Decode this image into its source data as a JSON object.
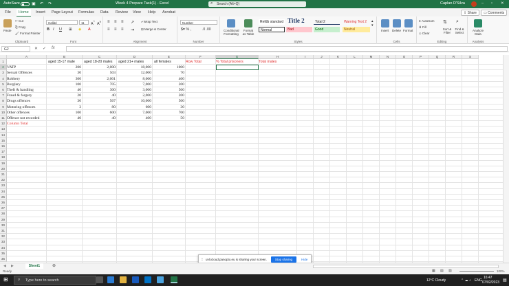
{
  "titlebar": {
    "autosave": "AutoSave",
    "autosave_state": "Off",
    "doc_title": "Week 4 Prepare Task(1) - Excel",
    "search": "Search (Alt+Q)",
    "user": "Caplan D'Silva"
  },
  "tabs": [
    "File",
    "Home",
    "Insert",
    "Page Layout",
    "Formulas",
    "Data",
    "Review",
    "View",
    "Help",
    "Acrobat"
  ],
  "active_tab": "Home",
  "share_label": "Share",
  "comments_label": "Comments",
  "ribbon": {
    "clipboard": {
      "label": "Clipboard",
      "paste": "Paste",
      "cut": "Cut",
      "copy": "Copy",
      "format_painter": "Format Painter"
    },
    "font": {
      "label": "Font",
      "name": "Calibri",
      "size": "11"
    },
    "alignment": {
      "label": "Alignment",
      "wrap": "Wrap Text",
      "merge": "Merge & Center"
    },
    "number": {
      "label": "Number",
      "format": "Number"
    },
    "styles": {
      "label": "Styles",
      "cond": "Conditional Formatting",
      "table": "Format as Table",
      "cells": [
        "Refdb standard",
        "Title 2",
        "Total 2",
        "Warning Text 2",
        "Normal",
        "Bad",
        "Good",
        "Neutral"
      ]
    },
    "cells": {
      "label": "Cells",
      "insert": "Insert",
      "delete": "Delete",
      "format": "Format"
    },
    "editing": {
      "label": "Editing",
      "autosum": "AutoSum",
      "fill": "Fill",
      "clear": "Clear",
      "sort": "Sort & Filter",
      "find": "Find & Select"
    },
    "analysis": {
      "label": "Analysis",
      "analyze": "Analyze Data"
    }
  },
  "formula_bar": {
    "name_box": "G2",
    "fx": "fx",
    "content": ""
  },
  "columns": [
    "A",
    "B",
    "C",
    "D",
    "E",
    "F",
    "G",
    "H",
    "I",
    "J",
    "K",
    "L",
    "M",
    "N",
    "O",
    "P",
    "Q",
    "R",
    "S"
  ],
  "row_count": 36,
  "headers_row1": {
    "B": "aged 15-17 male",
    "C": "aged 18-20 males",
    "D": "aged 21+ males",
    "E": "all females",
    "F": "Row Total",
    "G": "% Total prisoners",
    "H": "Total males"
  },
  "rows": [
    {
      "A": "VATP",
      "B": "200",
      "C": "2,000",
      "D": "18,000",
      "E": "1000"
    },
    {
      "A": "Sexual Offences",
      "B": "30",
      "C": "503",
      "D": "12,000",
      "E": "70"
    },
    {
      "A": "Robbery",
      "B": "300",
      "C": "2,001",
      "D": "8,000",
      "E": "400"
    },
    {
      "A": "Burglary",
      "B": "100",
      "C": "705",
      "D": "7,000",
      "E": "200"
    },
    {
      "A": "Theft & handling",
      "B": "40",
      "C": "300",
      "D": "3,000",
      "E": "500"
    },
    {
      "A": "Fraud & forgery",
      "B": "20",
      "C": "40",
      "D": "2,000",
      "E": "200"
    },
    {
      "A": "Drugs offences",
      "B": "30",
      "C": "567",
      "D": "10,000",
      "E": "500"
    },
    {
      "A": "Motoring offences",
      "B": "3",
      "C": "80",
      "D": "600",
      "E": "30"
    },
    {
      "A": "Other offences",
      "B": "100",
      "C": "600",
      "D": "7,000",
      "E": "700"
    },
    {
      "A": "Offence not recorded",
      "B": "40",
      "C": "40",
      "D": "400",
      "E": "50"
    },
    {
      "A": "Column Total"
    }
  ],
  "sheet": {
    "name": "Sheet1"
  },
  "status": {
    "ready": "Ready",
    "zoom": "100%"
  },
  "share_notice": {
    "text": "uvl.icloud.panopto.eu is sharing your screen.",
    "stop": "Stop sharing",
    "hide": "Hide"
  },
  "taskbar": {
    "search": "Type here to search",
    "weather": "12°C  Cloudy",
    "time": "16:47",
    "date": "07/02/2023",
    "lang": "ENG"
  },
  "colors": {
    "excel_green": "#217346",
    "red_text": "#e03030"
  }
}
